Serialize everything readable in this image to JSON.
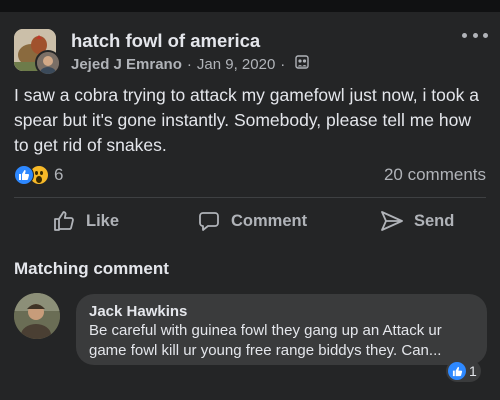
{
  "post": {
    "group_name": "hatch fowl of america",
    "author": "Jejed J Emrano",
    "date": "Jan 9, 2020",
    "text": "I saw a cobra trying to attack my gamefowl just now, i took a spear but it's gone instantly. Somebody, please tell me how to get rid of snakes.",
    "reaction_count": "6",
    "comments_count": "20 comments"
  },
  "actions": {
    "like": "Like",
    "comment": "Comment",
    "send": "Send"
  },
  "matching_comment": {
    "heading": "Matching comment",
    "author": "Jack Hawkins",
    "text": "Be careful with guinea fowl they gang up an Attack ur game fowl kill ur young free range biddys they. Can...",
    "like_count": "1"
  },
  "icons": {
    "more": "more-options-icon",
    "privacy": "group-members-icon",
    "like": "thumbs-up-icon",
    "comment": "speech-bubble-icon",
    "send": "send-arrow-icon"
  },
  "colors": {
    "background": "#242526",
    "like_blue": "#2d88ff",
    "wow_yellow": "#f7b928",
    "secondary_text": "#b0b3b8",
    "comment_bubble": "#3a3b3c"
  }
}
